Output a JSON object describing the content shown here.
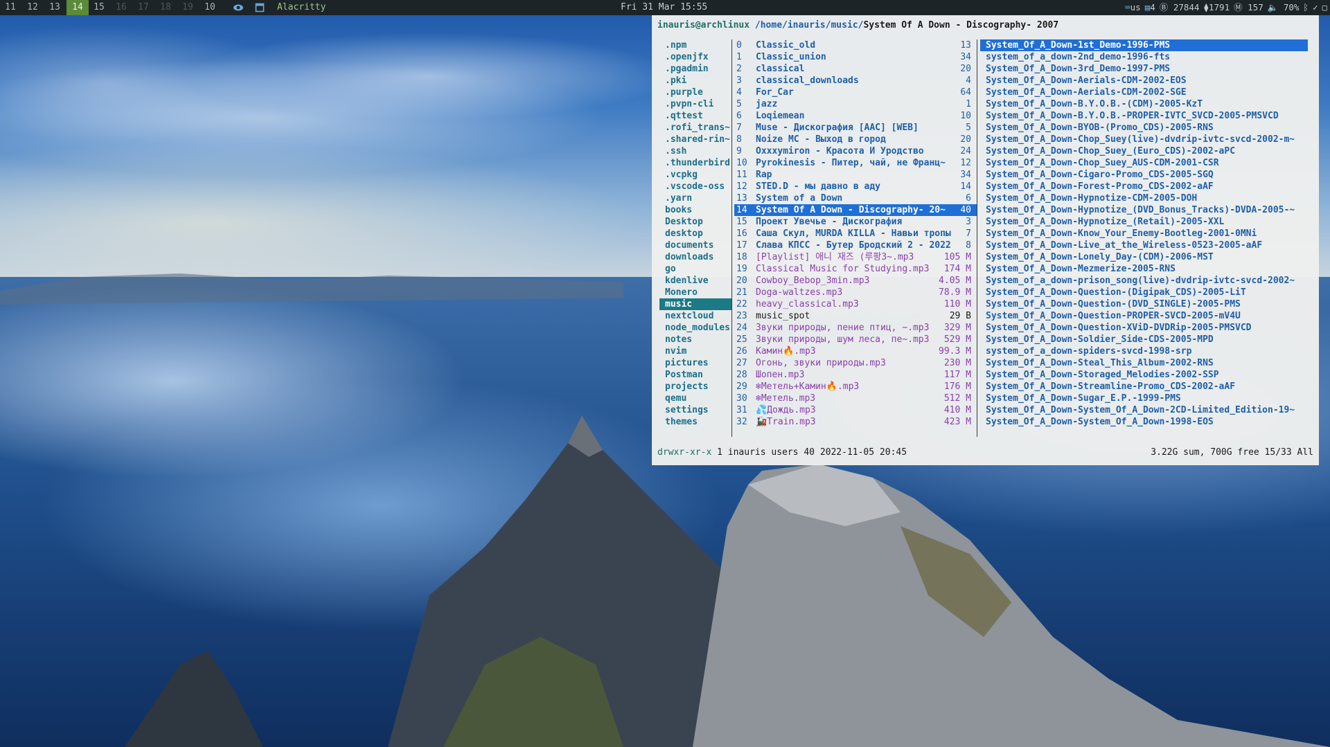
{
  "topbar": {
    "workspaces": [
      {
        "label": "11",
        "state": "normal"
      },
      {
        "label": "12",
        "state": "normal"
      },
      {
        "label": "13",
        "state": "normal"
      },
      {
        "label": "14",
        "state": "active"
      },
      {
        "label": "15",
        "state": "normal"
      },
      {
        "label": "16",
        "state": "dim"
      },
      {
        "label": "17",
        "state": "dim"
      },
      {
        "label": "18",
        "state": "dim"
      },
      {
        "label": "19",
        "state": "dim"
      },
      {
        "label": "10",
        "state": "normal"
      }
    ],
    "window_title": "Alacritty",
    "clock": "Fri 31 Mar 15:55",
    "status": {
      "keyboard": "us",
      "workspaces_count": "4",
      "btc": "27844",
      "eth": "1791",
      "xmr": "157",
      "volume": "70%"
    },
    "icons": [
      "eye-icon",
      "window-icon",
      "keyboard-icon",
      "bitcoin-icon",
      "ethereum-icon",
      "monero-icon",
      "volume-icon",
      "bluetooth-icon",
      "check-icon",
      "notification-icon"
    ]
  },
  "terminal": {
    "path": {
      "user": "inauris@archlinux",
      "dir": "/home/inauris/music/",
      "current": "System Of A Down - Discography- 2007"
    },
    "parent_dirs": [
      ".npm",
      ".openjfx",
      ".pgadmin",
      ".pki",
      ".purple",
      ".pvpn-cli",
      ".qttest",
      ".rofi_trans~",
      ".shared-rin~",
      ".ssh",
      ".thunderbird",
      ".vcpkg",
      ".vscode-oss",
      ".yarn",
      "books",
      "Desktop",
      "desktop",
      "documents",
      "downloads",
      "go",
      "kdenlive",
      "Monero",
      "music",
      "nextcloud",
      "node_modules",
      "notes",
      "nvim",
      "pictures",
      "Postman",
      "projects",
      "qemu",
      "settings",
      "themes"
    ],
    "parent_selected_index": 22,
    "music_entries": [
      {
        "idx": "0",
        "name": "Classic_old",
        "size": "13",
        "kind": "dir"
      },
      {
        "idx": "1",
        "name": "Classic_union",
        "size": "34",
        "kind": "dir"
      },
      {
        "idx": "2",
        "name": "classical",
        "size": "20",
        "kind": "dir"
      },
      {
        "idx": "3",
        "name": "classical_downloads",
        "size": "4",
        "kind": "dir"
      },
      {
        "idx": "4",
        "name": "For_Car",
        "size": "64",
        "kind": "dir"
      },
      {
        "idx": "5",
        "name": "jazz",
        "size": "1",
        "kind": "dir"
      },
      {
        "idx": "6",
        "name": "Loqiemean",
        "size": "10",
        "kind": "dir"
      },
      {
        "idx": "7",
        "name": "Muse - Дискография [AAC] [WEB]",
        "size": "5",
        "kind": "dir"
      },
      {
        "idx": "8",
        "name": "Noize MC - Выход в город",
        "size": "20",
        "kind": "dir"
      },
      {
        "idx": "9",
        "name": "Oxxxymiron - Красота И Уродство",
        "size": "24",
        "kind": "dir"
      },
      {
        "idx": "10",
        "name": "Pyrokinesis - Питер, чай, не Франц~",
        "size": "12",
        "kind": "dir"
      },
      {
        "idx": "11",
        "name": "Rap",
        "size": "34",
        "kind": "dir"
      },
      {
        "idx": "12",
        "name": "STED.D - мы давно в аду",
        "size": "14",
        "kind": "dir"
      },
      {
        "idx": "13",
        "name": "System of a Down",
        "size": "6",
        "kind": "dir"
      },
      {
        "idx": "14",
        "name": "System Of A Down - Discography- 20~",
        "size": "40",
        "kind": "dir"
      },
      {
        "idx": "15",
        "name": "Проект Увечье - Дискография",
        "size": "3",
        "kind": "dir"
      },
      {
        "idx": "16",
        "name": "Саша Скул, MURDA KILLA - Навьи тропы",
        "size": "7",
        "kind": "dir"
      },
      {
        "idx": "17",
        "name": "Слава КПСС - Бутер Бродский 2 - 2022",
        "size": "8",
        "kind": "dir"
      },
      {
        "idx": "18",
        "name": "[Playlist] 애니 재즈 (루팡3~.mp3",
        "size": "105 M",
        "kind": "file"
      },
      {
        "idx": "19",
        "name": "Classical Music for Studying.mp3",
        "size": "174 M",
        "kind": "file"
      },
      {
        "idx": "20",
        "name": "Cowboy_Bebop_3min.mp3",
        "size": "4.05 M",
        "kind": "file"
      },
      {
        "idx": "21",
        "name": "Doga-waltzes.mp3",
        "size": "78.9 M",
        "kind": "file"
      },
      {
        "idx": "22",
        "name": "heavy_classical.mp3",
        "size": "110 M",
        "kind": "file"
      },
      {
        "idx": "23",
        "name": "music_spot",
        "size": "29 B",
        "kind": "plain"
      },
      {
        "idx": "24",
        "name": "Звуки природы, пение птиц, ~.mp3",
        "size": "329 M",
        "kind": "file"
      },
      {
        "idx": "25",
        "name": "Звуки природы, шум леса, пе~.mp3",
        "size": "529 M",
        "kind": "file"
      },
      {
        "idx": "26",
        "name": "Камин🔥.mp3",
        "size": "99.3 M",
        "kind": "file"
      },
      {
        "idx": "27",
        "name": "Огонь, звуки природы.mp3",
        "size": "230 M",
        "kind": "file"
      },
      {
        "idx": "28",
        "name": "Шопен.mp3",
        "size": "117 M",
        "kind": "file"
      },
      {
        "idx": "29",
        "name": "❄Метель+Камин🔥.mp3",
        "size": "176 M",
        "kind": "file"
      },
      {
        "idx": "30",
        "name": "❄Метель.mp3",
        "size": "512 M",
        "kind": "file"
      },
      {
        "idx": "31",
        "name": "💦Дождь.mp3",
        "size": "410 M",
        "kind": "file"
      },
      {
        "idx": "32",
        "name": "🚂Train.mp3",
        "size": "423 M",
        "kind": "file"
      }
    ],
    "music_selected_index": 14,
    "preview_entries": [
      "System_Of_A_Down-1st_Demo-1996-PMS",
      "system_of_a_down-2nd_demo-1996-fts",
      "System_Of_A_Down-3rd_Demo-1997-PMS",
      "System_Of_A_Down-Aerials-CDM-2002-EOS",
      "System_Of_A_Down-Aerials-CDM-2002-SGE",
      "System_Of_A_Down-B.Y.O.B.-(CDM)-2005-KzT",
      "System_Of_A_Down-B.Y.O.B.-PROPER-IVTC_SVCD-2005-PMSVCD",
      "System_Of_A_Down-BYOB-(Promo_CDS)-2005-RNS",
      "System_Of_A_Down-Chop_Suey(live)-dvdrip-ivtc-svcd-2002-m~",
      "System_Of_A_Down-Chop_Suey_(Euro_CDS)-2002-aPC",
      "System_Of_A_Down-Chop_Suey_AUS-CDM-2001-CSR",
      "System_Of_A_Down-Cigaro-Promo_CDS-2005-SGQ",
      "System_Of_A_Down-Forest-Promo_CDS-2002-aAF",
      "System_Of_A_Down-Hypnotize-CDM-2005-DOH",
      "System_Of_A_Down-Hypnotize_(DVD_Bonus_Tracks)-DVDA-2005-~",
      "System_Of_A_Down-Hypnotize_(Retail)-2005-XXL",
      "System_Of_A_Down-Know_Your_Enemy-Bootleg-2001-0MNi",
      "System_Of_A_Down-Live_at_the_Wireless-0523-2005-aAF",
      "System_Of_A_Down-Lonely_Day-(CDM)-2006-MST",
      "System_Of_A_Down-Mezmerize-2005-RNS",
      "System_of_a_down-prison_song(live)-dvdrip-ivtc-svcd-2002~",
      "System_Of_A_Down-Question-(Digipak_CDS)-2005-LiT",
      "System_Of_A_Down-Question-(DVD_SINGLE)-2005-PMS",
      "System_Of_A_Down-Question-PROPER-SVCD-2005-mV4U",
      "System_Of_A_Down-Question-XViD-DVDRip-2005-PMSVCD",
      "System_Of_A_Down-Soldier_Side-CDS-2005-MPD",
      "system_of_a_down-spiders-svcd-1998-srp",
      "System_Of_A_Down-Steal_This_Album-2002-RNS",
      "System_Of_A_Down-Storaged_Melodies-2002-SSP",
      "System_Of_A_Down-Streamline-Promo_CDS-2002-aAF",
      "System_Of_A_Down-Sugar_E.P.-1999-PMS",
      "System_Of_A_Down-System_Of_A_Down-2CD-Limited_Edition-19~",
      "System_Of_A_Down-System_Of_A_Down-1998-EOS"
    ],
    "preview_selected_index": 0,
    "status": {
      "permissions": "drwxr-xr-x",
      "info": "1 inauris users 40 2022-11-05 20:45",
      "summary": "3.22G sum, 700G free  15/33   All"
    }
  },
  "colors": {
    "bar_bg": "#1c2428",
    "active_workspace": "#5b8a3a",
    "selection": "#1f6fd6",
    "parent_selection": "#1b7a84",
    "dir_text": "#1f5fa8",
    "file_text": "#8a3fae"
  }
}
